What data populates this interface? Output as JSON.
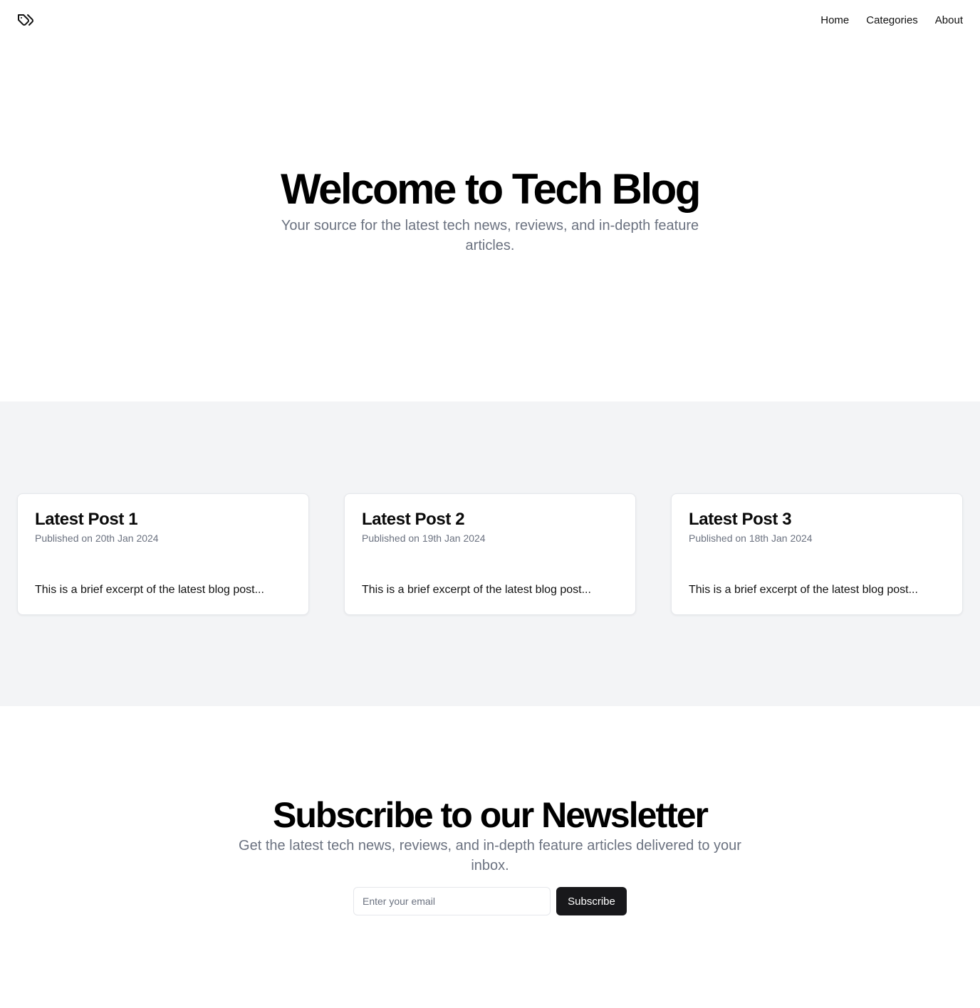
{
  "header": {
    "logo_icon": "tags-icon",
    "nav": [
      {
        "label": "Home"
      },
      {
        "label": "Categories"
      },
      {
        "label": "About"
      }
    ]
  },
  "hero": {
    "title": "Welcome to Tech Blog",
    "subtitle": "Your source for the latest tech news, reviews, and in-depth feature articles."
  },
  "posts": [
    {
      "title": "Latest Post 1",
      "date": "Published on 20th Jan 2024",
      "excerpt": "This is a brief excerpt of the latest blog post..."
    },
    {
      "title": "Latest Post 2",
      "date": "Published on 19th Jan 2024",
      "excerpt": "This is a brief excerpt of the latest blog post..."
    },
    {
      "title": "Latest Post 3",
      "date": "Published on 18th Jan 2024",
      "excerpt": "This is a brief excerpt of the latest blog post..."
    }
  ],
  "newsletter": {
    "title": "Subscribe to our Newsletter",
    "subtitle": "Get the latest tech news, reviews, and in-depth feature articles delivered to your inbox.",
    "email_placeholder": "Enter your email",
    "email_value": "",
    "button_label": "Subscribe"
  },
  "colors": {
    "section_bg": "#f3f4f6",
    "muted_text": "#6b7280",
    "button_bg": "#18181b"
  }
}
